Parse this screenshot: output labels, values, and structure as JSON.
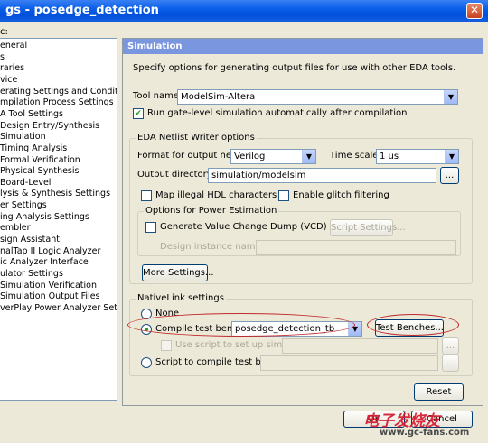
{
  "window": {
    "title": "gs - posedge_detection",
    "close_label": "✕"
  },
  "category": {
    "header": "c:",
    "items": [
      "eneral",
      "s",
      "raries",
      "vice",
      "erating Settings and Conditions",
      "mpilation Process Settings",
      "A Tool Settings",
      "Design Entry/Synthesis",
      "Simulation",
      "Timing Analysis",
      "Formal Verification",
      "Physical Synthesis",
      "Board-Level",
      "lysis & Synthesis Settings",
      "er Settings",
      "ing Analysis Settings",
      "embler",
      "sign Assistant",
      "nalTap II Logic Analyzer",
      "ic Analyzer Interface",
      "ulator Settings",
      "Simulation Verification",
      "Simulation Output Files",
      "verPlay Power Analyzer Settings"
    ]
  },
  "panel": {
    "title": "Simulation",
    "description": "Specify options for generating output files for use with other EDA tools.",
    "tool_name_label": "Tool name:",
    "tool_name_value": "ModelSim-Altera",
    "run_gate_level_label": "Run gate-level simulation automatically after compilation",
    "eda_group_label": "EDA Netlist Writer options",
    "format_label": "Format for output netlist:",
    "format_value": "Verilog",
    "time_scale_label": "Time scale:",
    "time_scale_value": "1 us",
    "output_dir_label": "Output directory:",
    "output_dir_value": "simulation/modelsim",
    "browse_label": "...",
    "map_illegal_label": "Map illegal HDL characters",
    "glitch_label": "Enable glitch filtering",
    "power_group_label": "Options for Power Estimation",
    "vcd_label": "Generate Value Change Dump (VCD) file script",
    "script_settings_label": "Script Settings...",
    "design_instance_label": "Design instance name:",
    "more_settings_label": "More Settings...",
    "nativelink_group_label": "NativeLink settings",
    "none_label": "None",
    "compile_tb_label": "Compile test bench:",
    "compile_tb_value": "posedge_detection_tb",
    "test_benches_label": "Test Benches...",
    "use_script_label": "Use script to set up simulation:",
    "script_compile_label": "Script to compile test bench:",
    "reset_label": "Reset"
  },
  "footer": {
    "ok_label": "OK",
    "cancel_label": "Cancel"
  },
  "watermark": {
    "text": "电子发烧友",
    "url": "www.gc-fans.com"
  },
  "colors": {
    "titlebar": "#0a5ee8",
    "panel_title": "#7a96df",
    "annotation": "#c0282a",
    "window_bg": "#ece9d8"
  }
}
